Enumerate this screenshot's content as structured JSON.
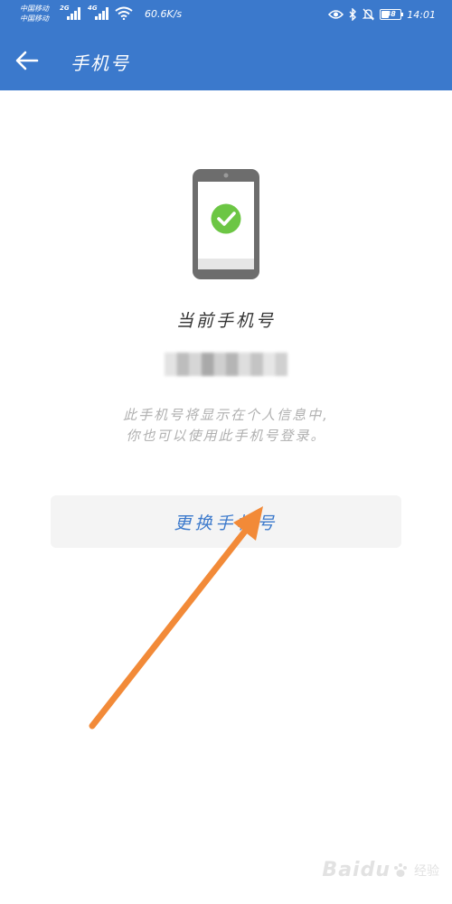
{
  "status_bar": {
    "carrier_1": "中国移动",
    "carrier_2": "中国移动",
    "network_1": "2G",
    "network_2": "4G",
    "speed": "60.6K/s",
    "battery_level": "38",
    "time": "14:01"
  },
  "app_bar": {
    "back_icon": "arrow-left-icon",
    "title": "手机号"
  },
  "content": {
    "illustration_icon": "phone-check-icon",
    "current_label": "当前手机号",
    "phone_number": "",
    "description_line_1": "此手机号将显示在个人信息中,",
    "description_line_2": "你也可以使用此手机号登录。",
    "change_button_label": "更换手机号"
  },
  "overlay": {
    "annotation_arrow": "orange-arrow",
    "watermark_text": "Baidu",
    "watermark_sub": "经验"
  },
  "colors": {
    "primary": "#3b79cc",
    "check_green": "#6cc644",
    "arrow_orange": "#f28a38",
    "button_bg": "#f4f4f4",
    "description_text": "#b0b0b0"
  }
}
